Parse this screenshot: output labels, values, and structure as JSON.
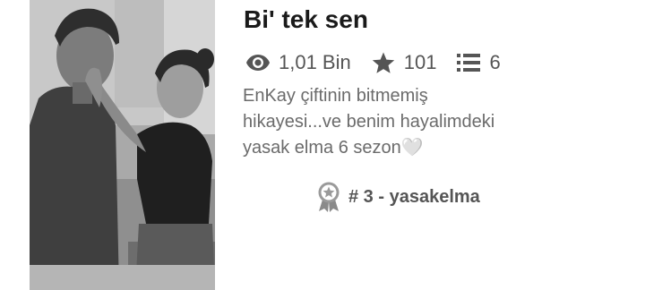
{
  "story": {
    "title": "Bi' tek sen",
    "stats": {
      "reads": "1,01 Bin",
      "votes": "101",
      "parts": "6"
    },
    "description_lines": [
      "EnKay çiftinin bitmemiş",
      "hikayesi...ve benim hayalimdeki",
      "yasak elma 6 sezon"
    ],
    "description_emoji": "🤍",
    "ranking": "# 3 - yasakelma"
  },
  "icons": {
    "reads": "eye-icon",
    "votes": "star-icon",
    "parts": "list-icon",
    "ranking": "ribbon-badge-icon"
  },
  "colors": {
    "title": "#1a1a1a",
    "stats": "#555555",
    "description": "#6b6b6b"
  }
}
